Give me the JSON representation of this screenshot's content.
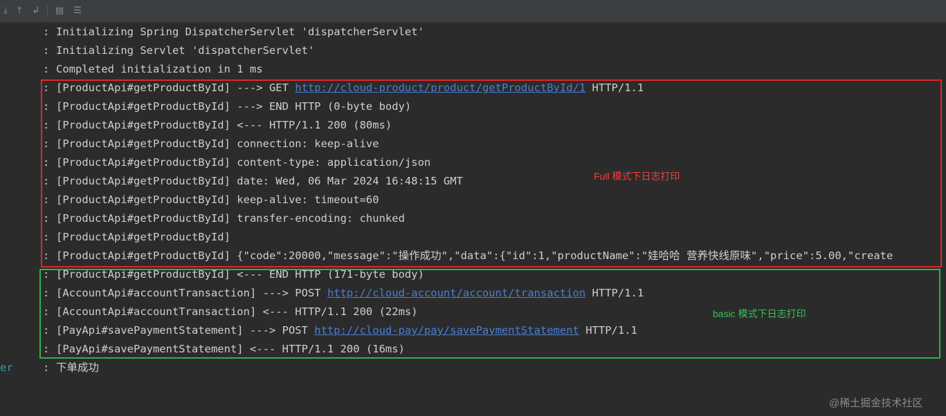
{
  "toolbar": {
    "icons": [
      "scroll-to-end-icon",
      "up-icon",
      "soft-wrap-icon",
      "print-icon",
      "settings-icon"
    ]
  },
  "logs": [
    {
      "logger": "",
      "text": "Initializing Spring DispatcherServlet 'dispatcherServlet'"
    },
    {
      "logger": "",
      "text": "Initializing Servlet 'dispatcherServlet'"
    },
    {
      "logger": "",
      "text": "Completed initialization in 1 ms"
    },
    {
      "logger": "",
      "pre": "[ProductApi#getProductById] ---> GET ",
      "link": "http://cloud-product/product/getProductById/1",
      "post": " HTTP/1.1"
    },
    {
      "logger": "",
      "text": "[ProductApi#getProductById] ---> END HTTP (0-byte body)"
    },
    {
      "logger": "",
      "text": "[ProductApi#getProductById] <--- HTTP/1.1 200 (80ms)"
    },
    {
      "logger": "",
      "text": "[ProductApi#getProductById] connection: keep-alive"
    },
    {
      "logger": "",
      "text": "[ProductApi#getProductById] content-type: application/json"
    },
    {
      "logger": "",
      "text": "[ProductApi#getProductById] date: Wed, 06 Mar 2024 16:48:15 GMT"
    },
    {
      "logger": "",
      "text": "[ProductApi#getProductById] keep-alive: timeout=60"
    },
    {
      "logger": "",
      "text": "[ProductApi#getProductById] transfer-encoding: chunked"
    },
    {
      "logger": "",
      "text": "[ProductApi#getProductById]"
    },
    {
      "logger": "",
      "text": "[ProductApi#getProductById] {\"code\":20000,\"message\":\"操作成功\",\"data\":{\"id\":1,\"productName\":\"娃哈哈 营养快线原味\",\"price\":5.00,\"create"
    },
    {
      "logger": "",
      "text": "[ProductApi#getProductById] <--- END HTTP (171-byte body)"
    },
    {
      "logger": "",
      "pre": "[AccountApi#accountTransaction] ---> POST ",
      "link": "http://cloud-account/account/transaction",
      "post": " HTTP/1.1"
    },
    {
      "logger": "",
      "text": "[AccountApi#accountTransaction] <--- HTTP/1.1 200 (22ms)"
    },
    {
      "logger": "",
      "pre": "[PayApi#savePaymentStatement] ---> POST ",
      "link": "http://cloud-pay/pay/savePaymentStatement",
      "post": " HTTP/1.1"
    },
    {
      "logger": "",
      "text": "[PayApi#savePaymentStatement] <--- HTTP/1.1 200 (16ms)"
    },
    {
      "logger": "er",
      "text": "下单成功"
    }
  ],
  "separator": ":",
  "annotations": {
    "full": "Full 模式下日志打印",
    "basic": "basic 模式下日志打印"
  },
  "watermark": "@稀土掘金技术社区",
  "colors": {
    "background": "#2b2b2b",
    "text": "#cfcfcf",
    "link": "#4a7fd4",
    "full_box": "#e0262a",
    "basic_box": "#2db34a",
    "logger_name": "#2aa2a8"
  }
}
